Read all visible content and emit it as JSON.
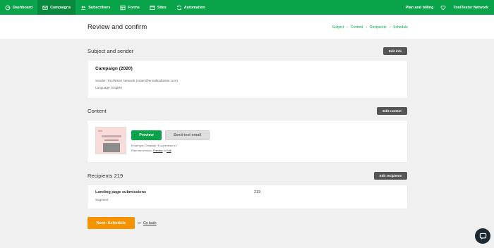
{
  "nav": {
    "items": [
      {
        "label": "Dashboard",
        "icon": "dashboard-icon",
        "active": false
      },
      {
        "label": "Campaigns",
        "icon": "envelope-icon",
        "active": true
      },
      {
        "label": "Subscribers",
        "icon": "users-icon",
        "active": false
      },
      {
        "label": "Forms",
        "icon": "forms-icon",
        "active": false
      },
      {
        "label": "Sites",
        "icon": "sites-icon",
        "active": false
      },
      {
        "label": "Automation",
        "icon": "automation-icon",
        "active": false
      }
    ],
    "plan_billing": "Plan and billing",
    "account": "ToolTester Network"
  },
  "header": {
    "title": "Review and confirm",
    "breadcrumb": [
      "Subject",
      "Content",
      "Recipients",
      "Schedule"
    ]
  },
  "subject_section": {
    "title": "Subject and sender",
    "edit_label": "Edit info",
    "campaign_name": "Campaign (2020)",
    "sender": "Sender: ToolTester Network (robert@emailtooltester.com)",
    "language": "Language: English"
  },
  "content_section": {
    "title": "Content",
    "edit_label": "Edit content",
    "preview_label": "Preview",
    "test_label": "Send test email",
    "email_type": "Email type: Template \"E-commerce #1\"",
    "plain_text_prefix": "Plain text version:",
    "plain_preview": "Preview",
    "plain_or": "or",
    "plain_edit": "Edit"
  },
  "recipients_section": {
    "title": "Recipients 219",
    "edit_label": "Edit recipients",
    "row": {
      "name": "Landing page submissions",
      "type": "Segment",
      "count": "219"
    }
  },
  "footer": {
    "next_label": "Next: Schedule",
    "or": "or",
    "back_label": "Go back"
  },
  "colors": {
    "brand_green": "#09a44a",
    "accent_orange": "#f59300",
    "dark_button": "#555555"
  }
}
